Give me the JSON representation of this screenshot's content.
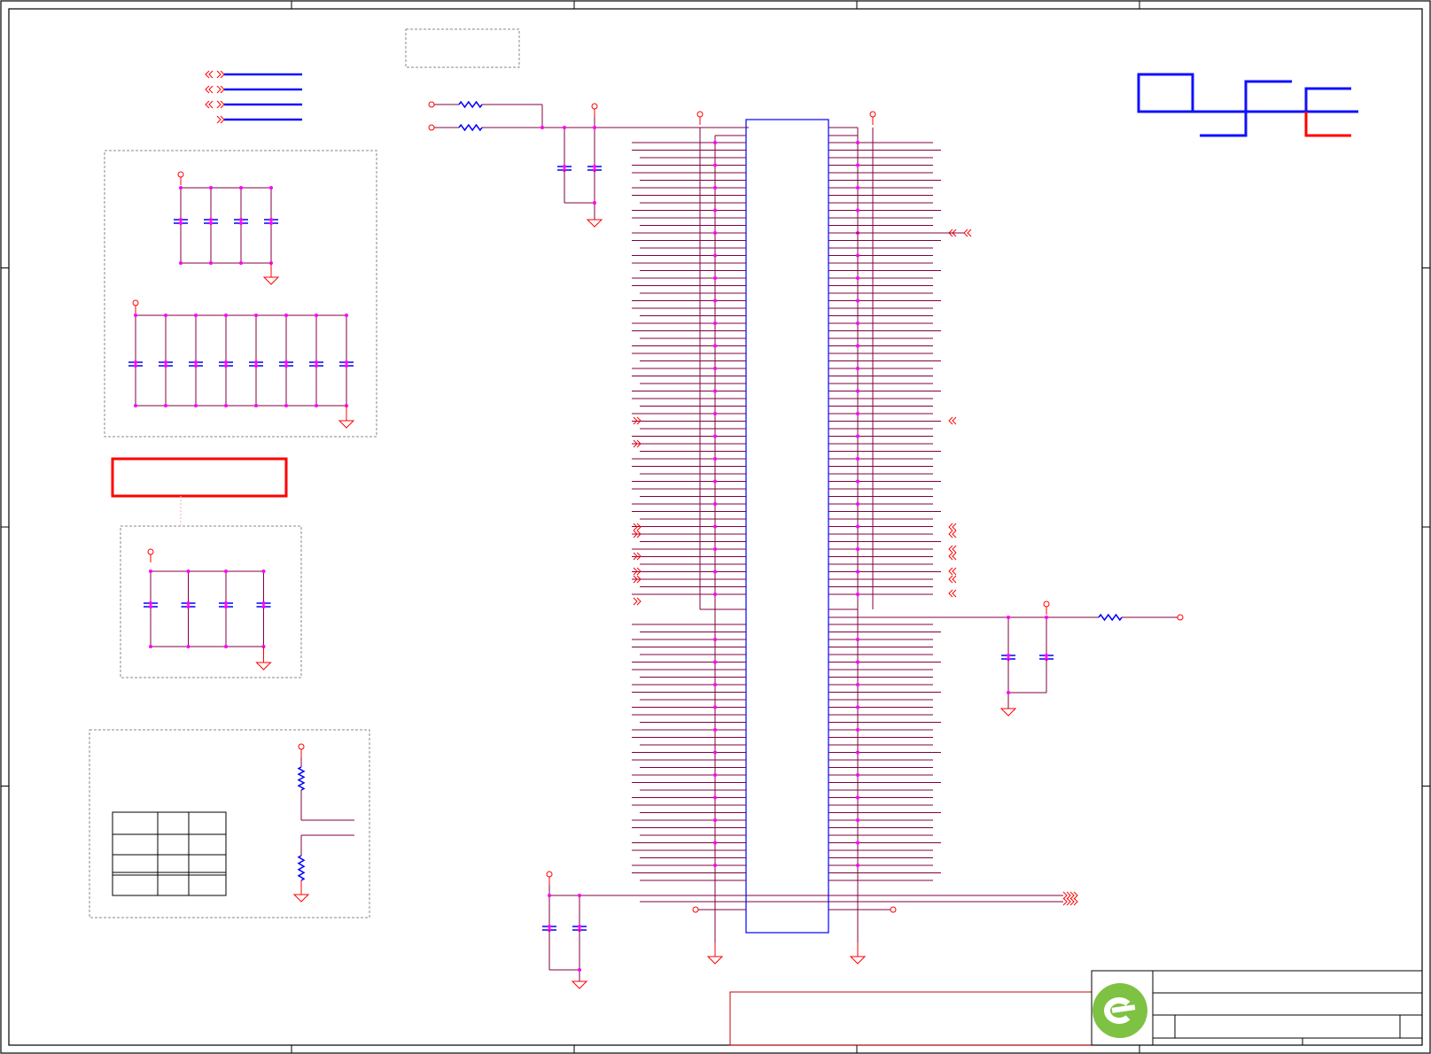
{
  "document": {
    "type": "schematic-sheet",
    "sheet_size": "A",
    "visible_text": []
  },
  "colors": {
    "frame": "#000000",
    "wire": "#800040",
    "power_net": "#ff0000",
    "component": "#0000ff",
    "junction": "#ff00ff",
    "box": "#888888",
    "highlight": "#ff0000",
    "logo": "#7dc242"
  },
  "diagram": {
    "frame_zones": {
      "columns": 5,
      "rows": 4
    },
    "legend": {
      "lines": 4,
      "line_color": "#1010ff"
    },
    "decap_groups": [
      {
        "name": "group-top",
        "capacitors": 4
      },
      {
        "name": "group-middle",
        "capacitors": 8
      },
      {
        "name": "group-lower",
        "capacitors": 4
      }
    ],
    "strap_table": {
      "rows": 4,
      "columns": 3
    },
    "ic": {
      "pins_per_side": 38
    },
    "logo": "eg-logo-icon"
  }
}
